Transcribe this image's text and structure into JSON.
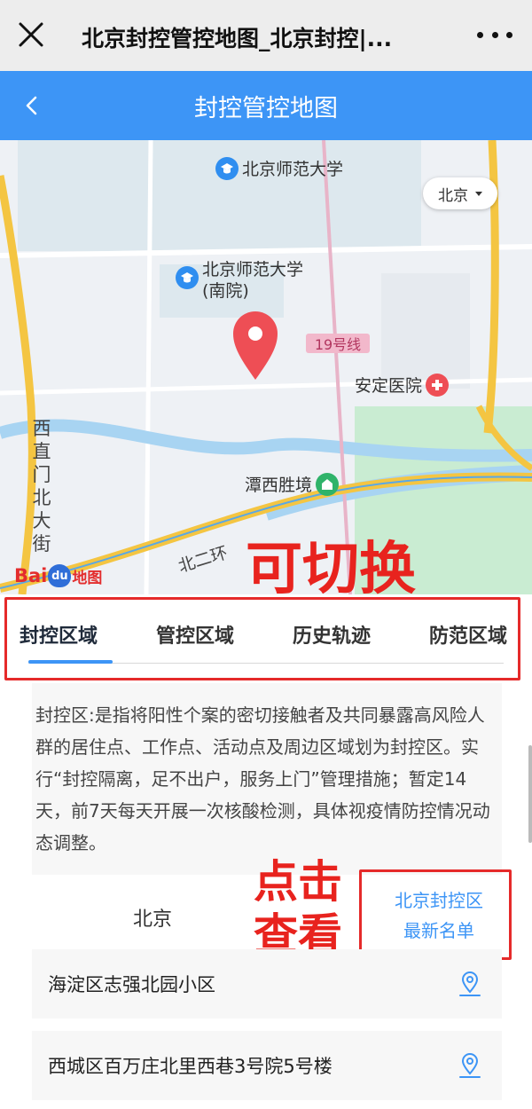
{
  "wechat_bar": {
    "title": "北京封控管控地图_北京封控|..."
  },
  "header": {
    "title": "封控管控地图"
  },
  "map": {
    "poi": {
      "bnu": "北京师范大学",
      "bnu_south_line1": "北京师范大学",
      "bnu_south_line2": "(南院)",
      "hospital": "安定医院",
      "park": "潭西胜境"
    },
    "city_selector": "北京",
    "metro_line": "19号线",
    "street": "西直门北大街",
    "ring_road": "北二环",
    "logo_text_1": "Bai",
    "logo_text_2": "du",
    "logo_text_3": "地图",
    "colors": {
      "road": "#f4c542",
      "water": "#a8d4f2",
      "green": "#c9ecd2",
      "metro": "#e8b4c8"
    }
  },
  "annotations": {
    "switchable": "可切换",
    "click_view": "点击查看"
  },
  "tabs": [
    {
      "label": "封控区域",
      "active": true
    },
    {
      "label": "管控区域",
      "active": false
    },
    {
      "label": "历史轨迹",
      "active": false
    },
    {
      "label": "防范区域",
      "active": false
    }
  ],
  "description": "封控区:是指将阳性个案的密切接触者及共同暴露高风险人群的居住点、工作点、活动点及周边区域划为封控区。实行“封控隔离，足不出户，服务上门”管理措施；暂定14天，前7天每天开展一次核酸检测，具体视疫情防控情况动态调整。",
  "city_label": "北京",
  "list_button": {
    "line1": "北京封控区",
    "line2": "最新名单"
  },
  "list_items": [
    {
      "name": "海淀区志强北园小区"
    },
    {
      "name": "西城区百万庄北里西巷3号院5号楼"
    }
  ],
  "colors": {
    "accent": "#3d95f6",
    "annotation": "#e8231e"
  }
}
